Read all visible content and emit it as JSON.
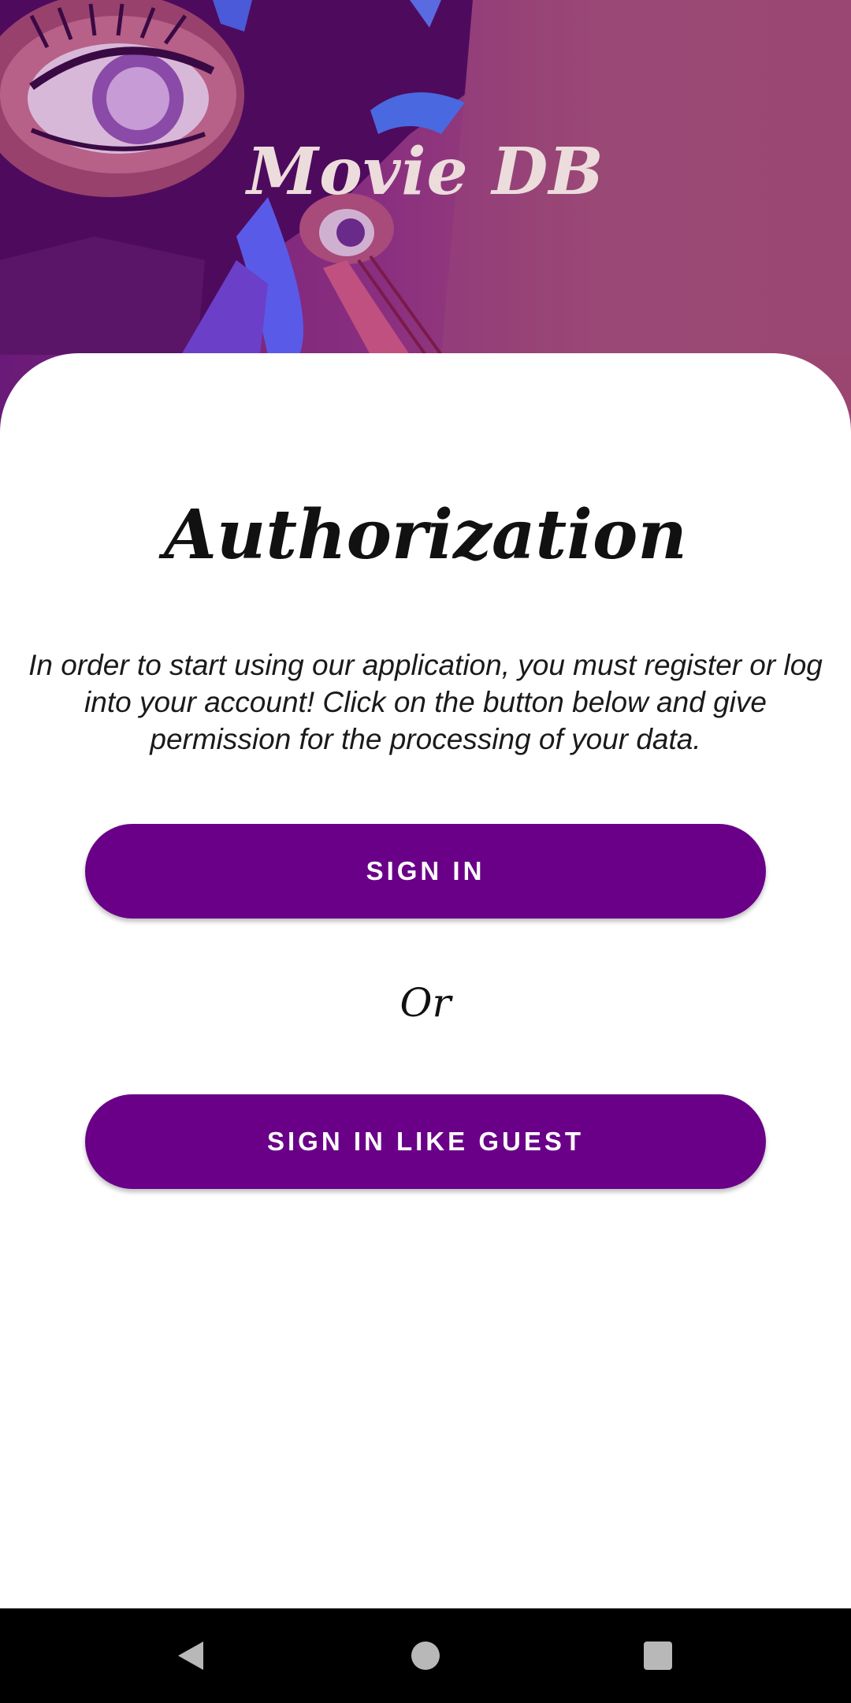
{
  "app": {
    "title": "Movie DB"
  },
  "auth": {
    "title": "Authorization",
    "description": "In order to start using our application, you must register or log into your account! Click on the button below and give permission for the processing of your data.",
    "sign_in_label": "SIGN IN",
    "or_label": "Or",
    "guest_label": "SIGN IN LIKE GUEST"
  },
  "navigation_bar": {
    "buttons": [
      "back-icon",
      "home-icon",
      "recents-icon"
    ]
  },
  "colors": {
    "accent": "#6a0088",
    "header_background": "#9b4670",
    "card_background": "#ffffff",
    "nav_background": "#000000"
  }
}
